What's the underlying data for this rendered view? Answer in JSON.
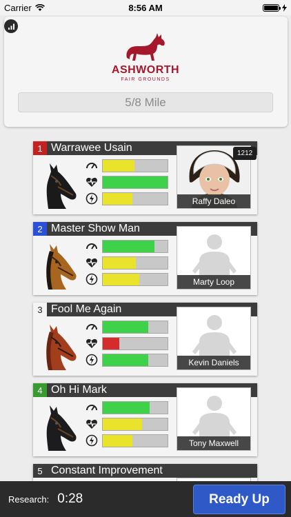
{
  "status_bar": {
    "carrier": "Carrier",
    "time": "8:56 AM"
  },
  "header": {
    "logo_title": "ASHWORTH",
    "logo_subtitle": "FAIR GROUNDS",
    "distance": "5/8 Mile"
  },
  "colors": {
    "green": "#3ed24a",
    "yellow": "#e9e32c",
    "red": "#d62b2b",
    "brand_red": "#a5172b",
    "button_blue": "#2e59c7"
  },
  "horses": [
    {
      "post": "1",
      "post_color": "#c42121",
      "name": "Warrawee Usain",
      "coat": "black",
      "jockey": "Raffy Daleo",
      "jockey_has_photo": true,
      "badge": "1212",
      "stats": [
        {
          "level": 0.49,
          "color": "yellow"
        },
        {
          "level": 1.0,
          "color": "green"
        },
        {
          "level": 0.46,
          "color": "yellow"
        }
      ]
    },
    {
      "post": "2",
      "post_color": "#2a4fd8",
      "name": "Master Show Man",
      "coat": "bay",
      "jockey": "Marty Loop",
      "jockey_has_photo": false,
      "badge": "",
      "stats": [
        {
          "level": 0.8,
          "color": "green"
        },
        {
          "level": 0.51,
          "color": "yellow"
        },
        {
          "level": 0.56,
          "color": "yellow"
        }
      ]
    },
    {
      "post": "3",
      "post_color": "#f4f4f4",
      "name": "Fool Me Again",
      "coat": "chestnut",
      "jockey": "Kevin Daniels",
      "jockey_has_photo": false,
      "badge": "",
      "stats": [
        {
          "level": 0.7,
          "color": "green"
        },
        {
          "level": 0.26,
          "color": "red"
        },
        {
          "level": 0.7,
          "color": "green"
        }
      ]
    },
    {
      "post": "4",
      "post_color": "#3a9a32",
      "name": "Oh Hi Mark",
      "coat": "black",
      "jockey": "Tony Maxwell",
      "jockey_has_photo": false,
      "badge": "",
      "stats": [
        {
          "level": 0.72,
          "color": "green"
        },
        {
          "level": 0.61,
          "color": "yellow"
        },
        {
          "level": 0.46,
          "color": "yellow"
        }
      ]
    },
    {
      "post": "5",
      "post_color": "#3c3c3c",
      "name": "Constant Improvement",
      "coat": "bay",
      "jockey": "",
      "jockey_has_photo": false,
      "badge": "",
      "stats": []
    }
  ],
  "footer": {
    "research_label": "Research:",
    "timer": "0:28",
    "ready_label": "Ready Up"
  }
}
